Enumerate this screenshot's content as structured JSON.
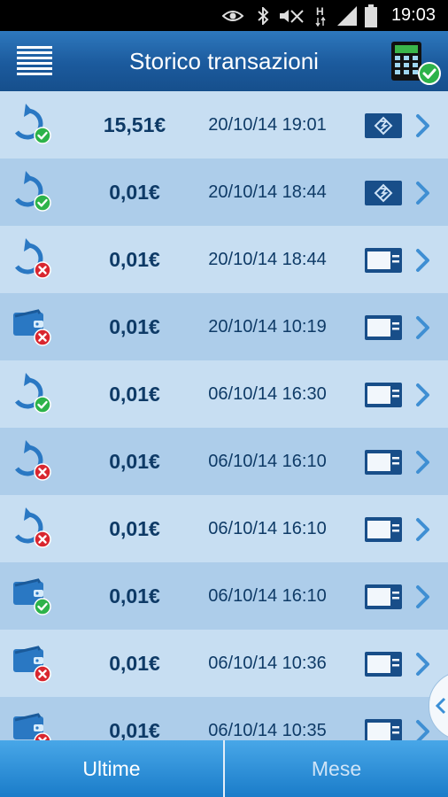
{
  "status_bar": {
    "time": "19:03",
    "icons": [
      "eye-icon",
      "bluetooth-icon",
      "mute-icon",
      "hsdpa-icon",
      "signal-icon",
      "battery-icon"
    ]
  },
  "header": {
    "title": "Storico transazioni",
    "menu_icon": "hamburger-icon",
    "action_icon": "pos-terminal-check-icon"
  },
  "colors": {
    "header": "#1b5a9d",
    "row_light": "#c7def2",
    "row_dark": "#adcdea",
    "text": "#0e3a66",
    "success": "#2db34a",
    "error": "#d9262f",
    "tab": "#2a8fd8"
  },
  "transactions": [
    {
      "type": "refund",
      "status": "success",
      "amount": "15,51€",
      "datetime": "20/10/14 19:01",
      "method": "contactless"
    },
    {
      "type": "refund",
      "status": "success",
      "amount": "0,01€",
      "datetime": "20/10/14 18:44",
      "method": "contactless"
    },
    {
      "type": "refund",
      "status": "failed",
      "amount": "0,01€",
      "datetime": "20/10/14 18:44",
      "method": "card"
    },
    {
      "type": "payment",
      "status": "failed",
      "amount": "0,01€",
      "datetime": "20/10/14 10:19",
      "method": "card"
    },
    {
      "type": "refund",
      "status": "success",
      "amount": "0,01€",
      "datetime": "06/10/14 16:30",
      "method": "card"
    },
    {
      "type": "refund",
      "status": "failed",
      "amount": "0,01€",
      "datetime": "06/10/14 16:10",
      "method": "card"
    },
    {
      "type": "refund",
      "status": "failed",
      "amount": "0,01€",
      "datetime": "06/10/14 16:10",
      "method": "card"
    },
    {
      "type": "payment",
      "status": "success",
      "amount": "0,01€",
      "datetime": "06/10/14 16:10",
      "method": "card"
    },
    {
      "type": "payment",
      "status": "failed",
      "amount": "0,01€",
      "datetime": "06/10/14 10:36",
      "method": "card"
    },
    {
      "type": "payment",
      "status": "failed",
      "amount": "0,01€",
      "datetime": "06/10/14 10:35",
      "method": "card"
    }
  ],
  "tabs": [
    {
      "label": "Ultime",
      "active": true
    },
    {
      "label": "Mese",
      "active": false
    }
  ],
  "side_tab_icon": "chevron-left-icon"
}
